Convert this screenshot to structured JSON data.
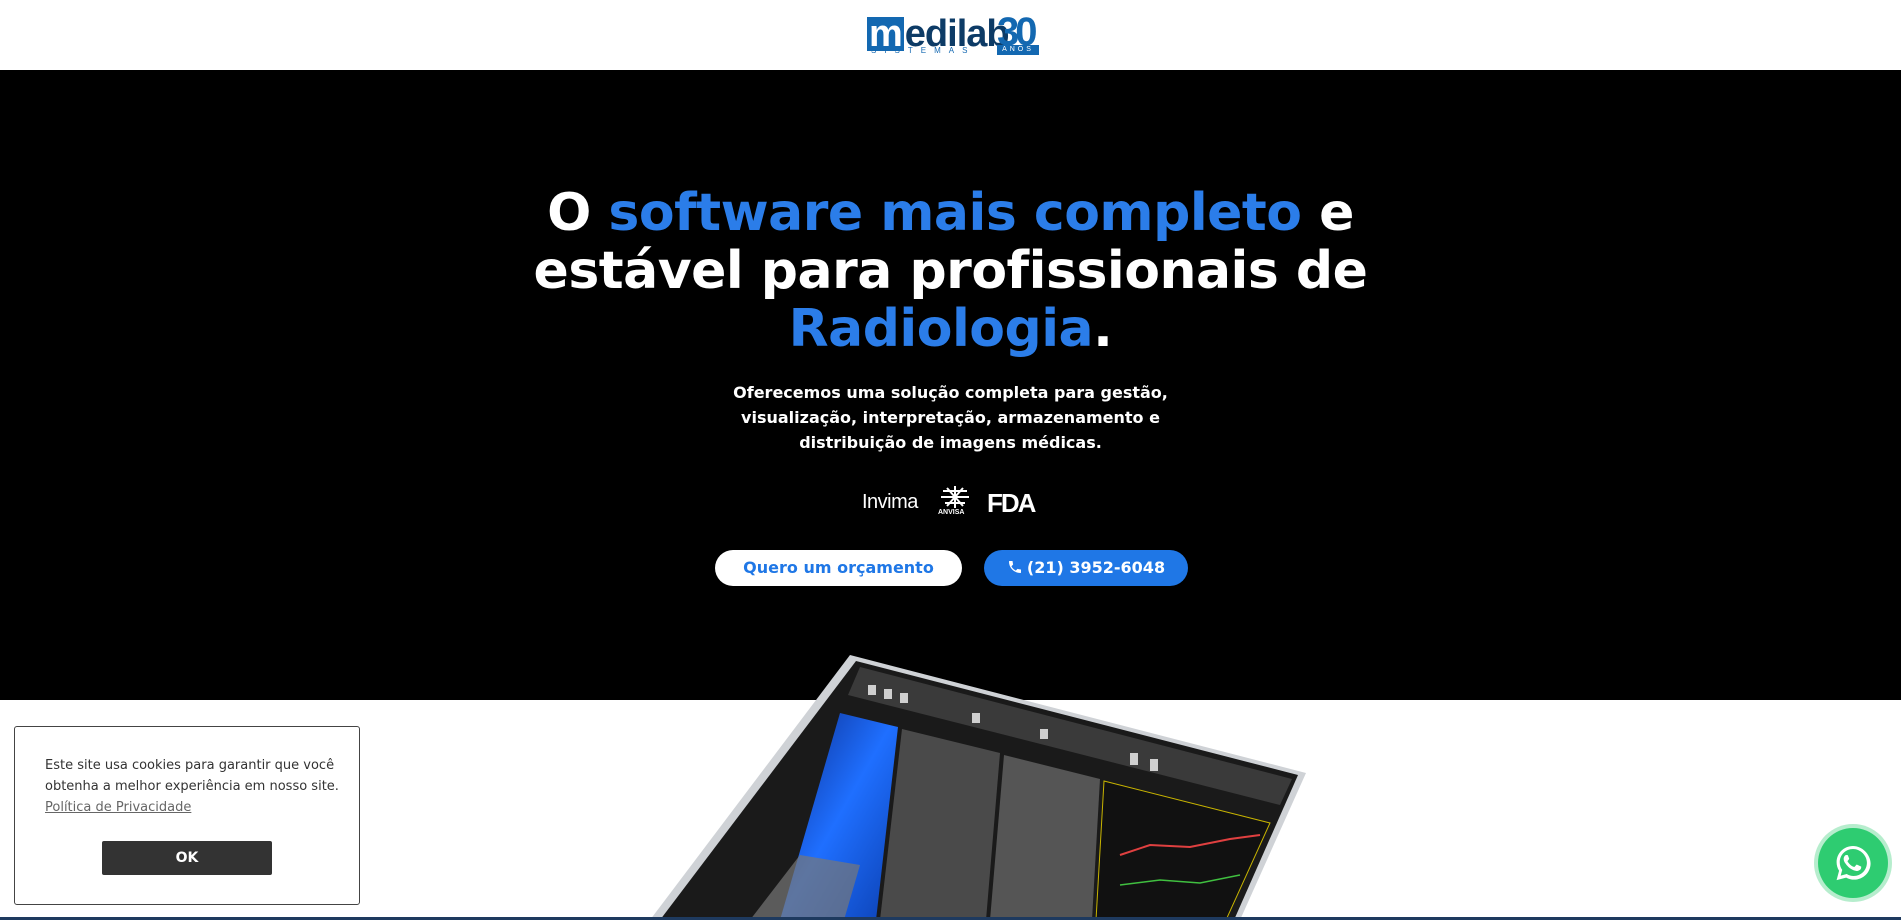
{
  "header": {
    "logo_word": "edilab",
    "logo_m": "m",
    "logo_sub": "SISTEMAS",
    "logo_badge_num": "30",
    "logo_badge_anos": "ANOS"
  },
  "hero": {
    "headline_part1": "O ",
    "headline_hl1": "software mais completo",
    "headline_part2": " e estável para profissionais de ",
    "headline_hl2": "Radiologia",
    "headline_part3": ".",
    "subtext": "Oferecemos uma solução completa para gestão, visualização, interpretação, armazenamento e distribuição de imagens médicas.",
    "cert_invima": "Invima",
    "cert_anvisa": "ANVISA",
    "cert_fda": "FDA",
    "quote_button": "Quero um orçamento",
    "phone_button": "(21) 3952-6048"
  },
  "cookie": {
    "text": "Este site usa cookies para garantir que você obtenha a melhor experiência em nosso site.",
    "link": "Política de Privacidade",
    "ok_button": "OK"
  },
  "colors": {
    "accent_blue": "#2b7de9",
    "button_blue": "#1f77e6",
    "hero_bg": "#000000",
    "whatsapp_green": "#2ecc71"
  }
}
